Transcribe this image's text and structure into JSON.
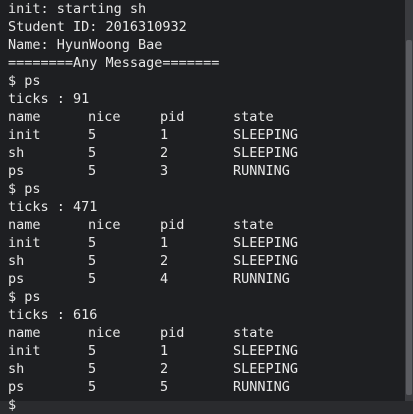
{
  "terminal": {
    "header_lines": [
      "init: starting sh",
      "Student ID: 2016310932",
      "Name: HyunWoong Bae",
      "========Any Message======="
    ],
    "runs": [
      {
        "prompt": "$ ps",
        "ticks": "ticks : 91",
        "columns": [
          "name",
          "nice",
          "pid",
          "state"
        ],
        "rows": [
          [
            "init",
            "5",
            "1",
            "SLEEPING"
          ],
          [
            "sh",
            "5",
            "2",
            "SLEEPING"
          ],
          [
            "ps",
            "5",
            "3",
            "RUNNING"
          ]
        ]
      },
      {
        "prompt": "$ ps",
        "ticks": "ticks : 471",
        "columns": [
          "name",
          "nice",
          "pid",
          "state"
        ],
        "rows": [
          [
            "init",
            "5",
            "1",
            "SLEEPING"
          ],
          [
            "sh",
            "5",
            "2",
            "SLEEPING"
          ],
          [
            "ps",
            "5",
            "4",
            "RUNNING"
          ]
        ]
      },
      {
        "prompt": "$ ps",
        "ticks": "ticks : 616",
        "columns": [
          "name",
          "nice",
          "pid",
          "state"
        ],
        "rows": [
          [
            "init",
            "5",
            "1",
            "SLEEPING"
          ],
          [
            "sh",
            "5",
            "2",
            "SLEEPING"
          ],
          [
            "ps",
            "5",
            "5",
            "RUNNING"
          ]
        ]
      }
    ],
    "final_prompt": "$ "
  }
}
